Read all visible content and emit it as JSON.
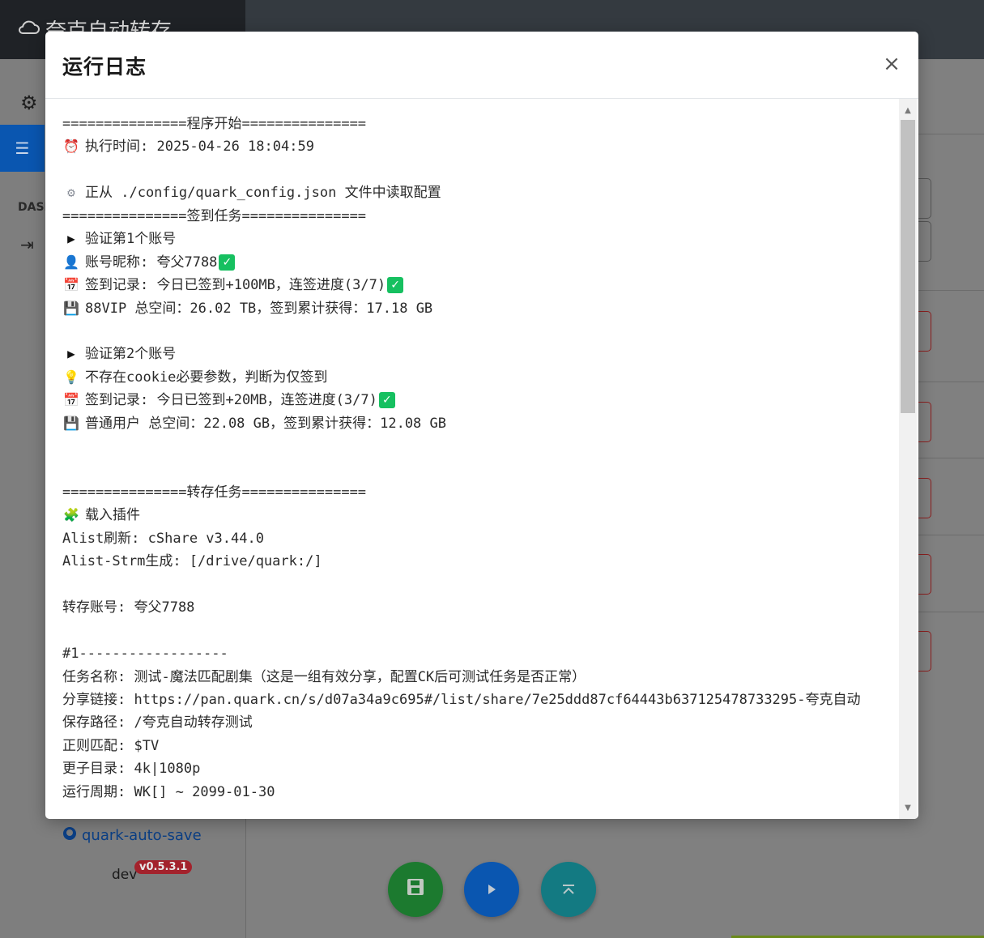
{
  "app": {
    "brand": "夸克自动转存",
    "sidebar_section": "DASI",
    "github_link": "quark-auto-save",
    "dev_label": "dev",
    "version_badge": "v0.5.3.1"
  },
  "modal": {
    "title": "运行日志",
    "close_label": "×"
  },
  "log_lines": [
    {
      "icon": "",
      "text": "===============程序开始==============="
    },
    {
      "icon": "⏰",
      "text": "执行时间: 2025-04-26 18:04:59"
    },
    {
      "icon": "",
      "text": ""
    },
    {
      "icon": "⚙",
      "text": "正从 ./config/quark_config.json 文件中读取配置"
    },
    {
      "icon": "",
      "text": "===============签到任务==============="
    },
    {
      "icon": "▶",
      "text": "验证第1个账号"
    },
    {
      "icon": "👤",
      "text": "账号昵称: 夸父7788",
      "check": true
    },
    {
      "icon": "📅",
      "text": "签到记录: 今日已签到+100MB，连签进度(3/7)",
      "check": true
    },
    {
      "icon": "💾",
      "text": "88VIP 总空间：26.02 TB，签到累计获得：17.18 GB"
    },
    {
      "icon": "",
      "text": ""
    },
    {
      "icon": "▶",
      "text": "验证第2个账号"
    },
    {
      "icon": "💡",
      "text": "不存在cookie必要参数，判断为仅签到"
    },
    {
      "icon": "📅",
      "text": "签到记录: 今日已签到+20MB，连签进度(3/7)",
      "check": true
    },
    {
      "icon": "💾",
      "text": "普通用户 总空间：22.08 GB，签到累计获得：12.08 GB"
    },
    {
      "icon": "",
      "text": ""
    },
    {
      "icon": "",
      "text": ""
    },
    {
      "icon": "",
      "text": "===============转存任务==============="
    },
    {
      "icon": "🧩",
      "text": "载入插件"
    },
    {
      "icon": "",
      "text": "Alist刷新: cShare v3.44.0"
    },
    {
      "icon": "",
      "text": "Alist-Strm生成: [/drive/quark:/]"
    },
    {
      "icon": "",
      "text": ""
    },
    {
      "icon": "",
      "text": "转存账号: 夸父7788"
    },
    {
      "icon": "",
      "text": ""
    },
    {
      "icon": "",
      "text": "#1------------------"
    },
    {
      "icon": "",
      "text": "任务名称: 测试-魔法匹配剧集（这是一组有效分享，配置CK后可测试任务是否正常）"
    },
    {
      "icon": "",
      "text": "分享链接: https://pan.quark.cn/s/d07a34a9c695#/list/share/7e25ddd87cf64443b637125478733295-夸克自动"
    },
    {
      "icon": "",
      "text": "保存路径: /夸克自动转存测试"
    },
    {
      "icon": "",
      "text": "正则匹配: $TV"
    },
    {
      "icon": "",
      "text": "更子目录: 4k|1080p"
    },
    {
      "icon": "",
      "text": "运行周期: WK[] ~ 2099-01-30"
    }
  ]
}
